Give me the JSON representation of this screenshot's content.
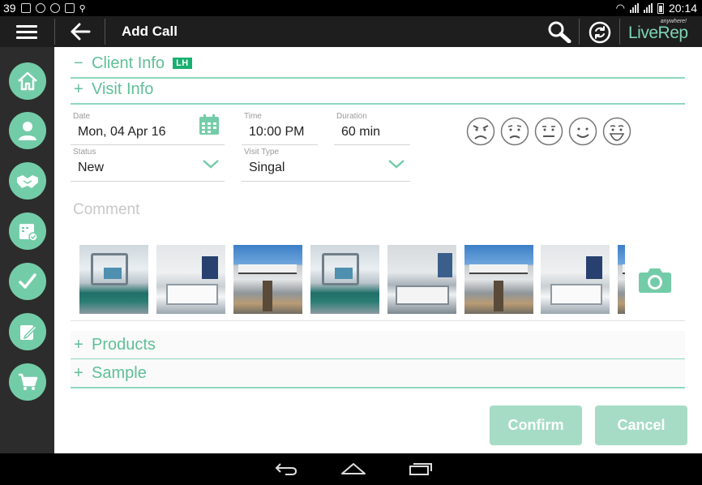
{
  "status_bar": {
    "notification_count": "39",
    "time": "20:14"
  },
  "app_bar": {
    "title": "Add Call",
    "brand_name": "LiveRep",
    "brand_tagline": "anywhere!"
  },
  "sidebar": {
    "items": [
      {
        "icon": "home-icon"
      },
      {
        "icon": "person-icon"
      },
      {
        "icon": "handshake-icon"
      },
      {
        "icon": "calendar-check-icon"
      },
      {
        "icon": "checkmark-icon"
      },
      {
        "icon": "edit-note-icon"
      },
      {
        "icon": "cart-icon"
      }
    ]
  },
  "sections": {
    "client_info": {
      "sign": "−",
      "label": "Client Info",
      "badge": "LH"
    },
    "visit_info": {
      "sign": "+",
      "label": "Visit Info"
    },
    "products": {
      "sign": "+",
      "label": "Products"
    },
    "sample": {
      "sign": "+",
      "label": "Sample"
    }
  },
  "form": {
    "date": {
      "label": "Date",
      "value": "Mon, 04 Apr 16"
    },
    "time": {
      "label": "Time",
      "value": "10:00 PM"
    },
    "duration": {
      "label": "Duration",
      "value": "60 min"
    },
    "status": {
      "label": "Status",
      "value": "New"
    },
    "visit_type": {
      "label": "Visit Type",
      "value": "Singal"
    },
    "comment_placeholder": "Comment"
  },
  "mood_faces": [
    "angry",
    "sad",
    "neutral",
    "happy",
    "very-happy"
  ],
  "attachments": [
    {
      "kind": "operating-room"
    },
    {
      "kind": "hospital-bed"
    },
    {
      "kind": "hospital-building"
    },
    {
      "kind": "operating-room"
    },
    {
      "kind": "hospital-bed"
    },
    {
      "kind": "hospital-building"
    },
    {
      "kind": "hospital-bed"
    },
    {
      "kind": "hospital-building"
    }
  ],
  "buttons": {
    "confirm": "Confirm",
    "cancel": "Cancel"
  },
  "colors": {
    "accent": "#73cca8",
    "section_text": "#5fbf99",
    "button": "#a6dcc6",
    "badge": "#17b070"
  }
}
